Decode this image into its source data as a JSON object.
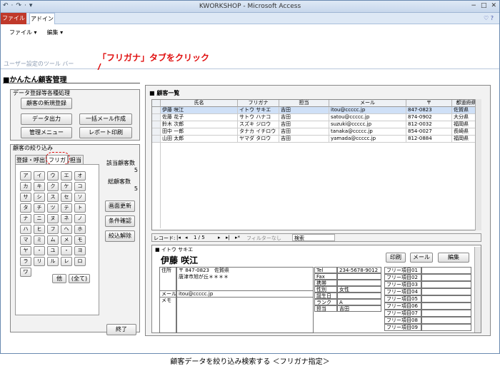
{
  "window": {
    "title": "KWORKSHOP - Microsoft Access",
    "controls": [
      "−",
      "□",
      "✕"
    ]
  },
  "qat": [
    "↶",
    "·",
    "↷",
    "·",
    "▾"
  ],
  "ribbon": {
    "file_tab": "ファイル",
    "addin_tab": "アドイン",
    "right_icons": "♡ ?",
    "menu_file": "ファイル ▾",
    "menu_edit": "編集 ▾",
    "group_label": "ユーザー設定のツール バー"
  },
  "callout": "「フリガナ」タブをクリック",
  "app": {
    "title": "■かんたん顧客管理"
  },
  "section1": {
    "label": "データ登録等各種処理",
    "buttons": [
      "顧客の新規登録",
      "データ出力",
      "一括メール作成",
      "管理メニュー",
      "レポート印刷"
    ]
  },
  "section2": {
    "label": "顧客の絞り込み",
    "tabs": [
      "登録・呼出",
      "フリガナ",
      "担当"
    ]
  },
  "kana_rows": [
    [
      "ア",
      "イ",
      "ウ",
      "エ",
      "オ"
    ],
    [
      "カ",
      "キ",
      "ク",
      "ケ",
      "コ"
    ],
    [
      "サ",
      "シ",
      "ス",
      "セ",
      "ソ"
    ],
    [
      "タ",
      "チ",
      "ツ",
      "テ",
      "ト"
    ],
    [
      "ナ",
      "ニ",
      "ヌ",
      "ネ",
      "ノ"
    ],
    [
      "ハ",
      "ヒ",
      "フ",
      "ヘ",
      "ホ"
    ],
    [
      "マ",
      "ミ",
      "ム",
      "メ",
      "モ"
    ],
    [
      "ヤ",
      "・",
      "ユ",
      "・",
      "ヨ"
    ],
    [
      "ラ",
      "リ",
      "ル",
      "レ",
      "ロ"
    ],
    [
      "ワ"
    ]
  ],
  "kana_extra": {
    "other": "他",
    "all": "(全て)"
  },
  "stats": {
    "match_label": "該当顧客数",
    "match_value": "5",
    "total_label": "総顧客数",
    "total_value": "5"
  },
  "side_buttons": [
    "画面更新",
    "条件確認",
    "絞込解除"
  ],
  "end_button": "終了",
  "list": {
    "title": "顧客一覧",
    "columns": [
      "氏名",
      "フリガナ",
      "担当",
      "メール",
      "〒",
      "都道府県"
    ],
    "rows": [
      [
        "伊藤 咲江",
        "イトウ サキエ",
        "吉田",
        "itou@ccccc.jp",
        "847-0823",
        "佐賀県"
      ],
      [
        "佐藤 花子",
        "サトウ ハナコ",
        "吉田",
        "satou@ccccc.jp",
        "874-0902",
        "大分県"
      ],
      [
        "鈴木 次郎",
        "スズキ ジロウ",
        "吉田",
        "suzuki@ccccc.jp",
        "812-0032",
        "福岡県"
      ],
      [
        "田中 一郎",
        "タナカ イチロウ",
        "吉田",
        "tanaka@ccccc.jp",
        "854-0027",
        "長崎県"
      ],
      [
        "山田 太郎",
        "ヤマダ タロウ",
        "吉田",
        "yamada@ccccc.jp",
        "812-0884",
        "福岡県"
      ]
    ]
  },
  "nav": {
    "record_label": "レコード:",
    "first": "|◂",
    "prev": "◂",
    "position": "1 / 5",
    "next": "▸",
    "last": "▸|",
    "new": "▸*",
    "filter": "フィルターなし",
    "search": "検索"
  },
  "detail": {
    "furigana": "イトウ サキエ",
    "name": "伊藤 咲江",
    "print": "印刷",
    "mail": "メール",
    "edit": "編集",
    "address_label": "住所",
    "postal": "〒 847-0823",
    "prefecture": "佐賀県",
    "street": "唐津市旭が丘＊＊＊＊",
    "email_label": "メール",
    "email": "itou@ccccc.jp",
    "memo_label": "メモ",
    "tel_label": "Tel",
    "tel": "234-5678-9012",
    "fax_label": "Fax",
    "mobile_label": "携帯",
    "sex_label": "性別",
    "sex": "女性",
    "birth_label": "誕生日",
    "rank_label": "ランク",
    "rank": "A",
    "staff_label": "担当",
    "staff": "吉田",
    "free_items": [
      "フリー項目01",
      "フリー項目02",
      "フリー項目03",
      "フリー項目04",
      "フリー項目05",
      "フリー項目06",
      "フリー項目07",
      "フリー項目08",
      "フリー項目09"
    ]
  },
  "caption": "顧客データを絞り込み検索する ＜フリガナ指定＞",
  "colors": {
    "accent_red": "#e01010",
    "file_tab": "#c0392b",
    "selected_row": "#cfe0f7"
  }
}
